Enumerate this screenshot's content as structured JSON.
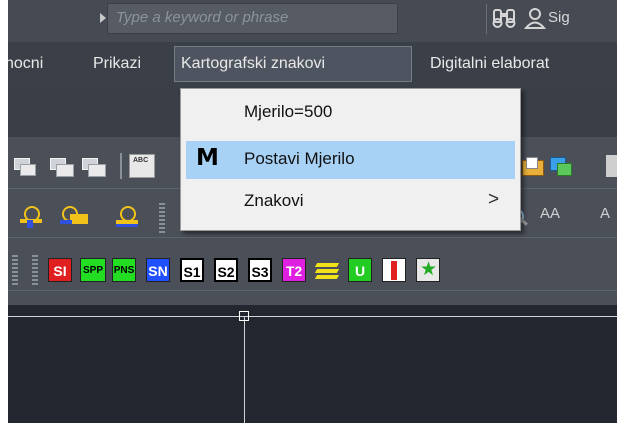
{
  "search": {
    "placeholder": "Type a keyword or phrase"
  },
  "header": {
    "signin": "Sig"
  },
  "menu": {
    "items": [
      {
        "label": "nocni"
      },
      {
        "label": "Prikazi"
      },
      {
        "label": "Kartografski znakovi"
      },
      {
        "label": "Digitalni elaborat"
      }
    ]
  },
  "dropdown": {
    "items": [
      {
        "label": "Mjerilo=500",
        "icon": ""
      },
      {
        "label": "Postavi Mjerilo",
        "icon": "M"
      },
      {
        "label": "Znakovi",
        "submenu": ">"
      }
    ]
  },
  "toolbar": {
    "text_icons": [
      "AA",
      "A"
    ],
    "symbols": [
      {
        "label": "SI",
        "fg": "#ffffff",
        "bg": "#e02020"
      },
      {
        "label": "SPP",
        "fg": "#000000",
        "bg": "#22dd22"
      },
      {
        "label": "PNS",
        "fg": "#000000",
        "bg": "#22dd22"
      },
      {
        "label": "SN",
        "fg": "#ffffff",
        "bg": "#2050ff"
      },
      {
        "label": "S1",
        "fg": "#000000",
        "bg": "#ffffff"
      },
      {
        "label": "S2",
        "fg": "#000000",
        "bg": "#ffffff"
      },
      {
        "label": "S3",
        "fg": "#000000",
        "bg": "#ffffff"
      },
      {
        "label": "T2",
        "fg": "#ffffff",
        "bg": "#e020e0"
      },
      {
        "label": "U",
        "fg": "#ffffff",
        "bg": "#22cc22"
      }
    ]
  },
  "colors": {
    "accent_highlight": "#a7d2f5",
    "menu_bg": "#3b4048",
    "canvas_bg": "#232830"
  }
}
